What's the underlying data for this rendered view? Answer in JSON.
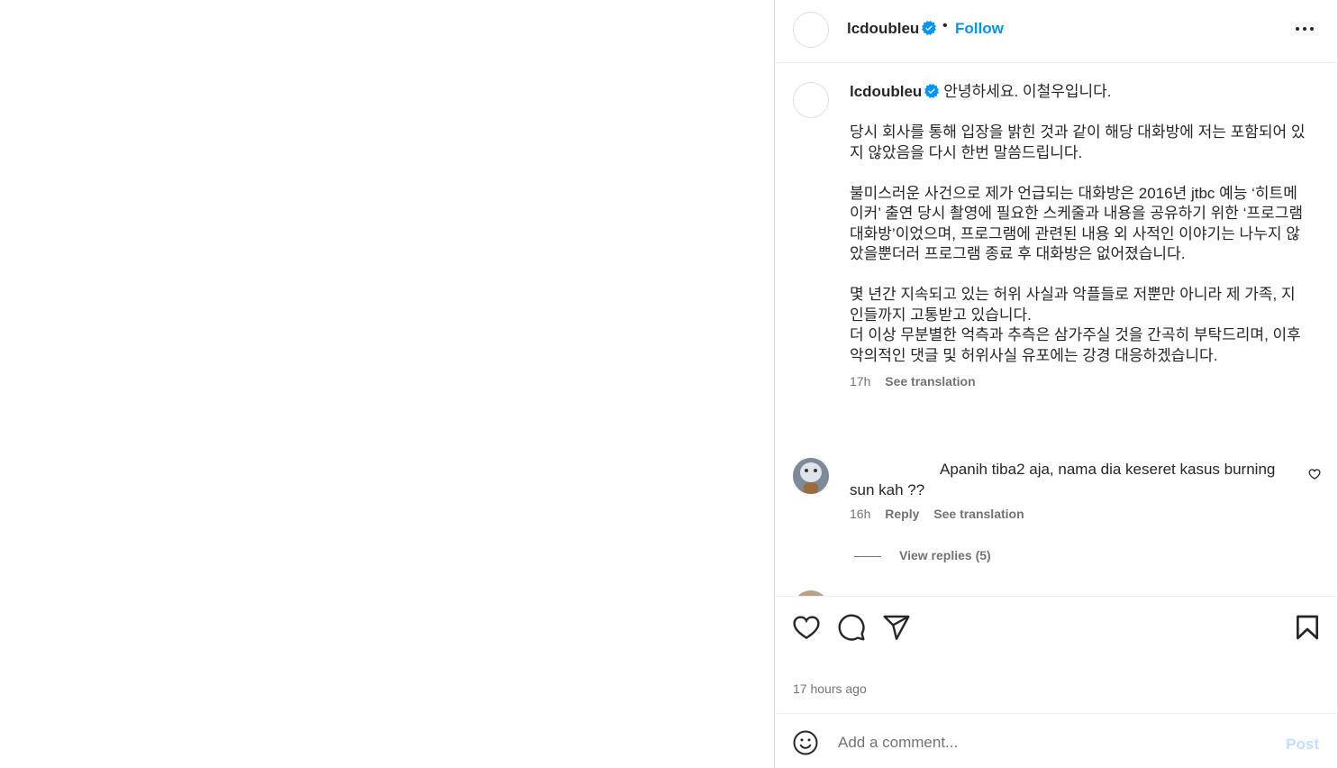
{
  "colors": {
    "accent": "#0095f6",
    "verified": "#0095f6",
    "text": "#262626",
    "muted": "#737373",
    "post_disabled": "#c0dffd"
  },
  "header": {
    "username": "lcdoubleu",
    "separator": "•",
    "follow_label": "Follow"
  },
  "caption": {
    "username": "lcdoubleu",
    "paragraphs": [
      "안녕하세요. 이철우입니다.",
      "당시 회사를 통해 입장을 밝힌 것과 같이 해당 대화방에 저는 포함되어 있지 않았음을 다시 한번 말씀드립니다.",
      "불미스러운 사건으로 제가 언급되는 대화방은 2016년 jtbc 예능 ‘히트메이커’ 출연 당시 촬영에 필요한 스케줄과 내용을 공유하기 위한 ‘프로그램 대화방’이었으며, 프로그램에 관련된 내용 외 사적인 이야기는 나누지 않았을뿐더러 프로그램 종료 후 대화방은 없어졌습니다.",
      "몇 년간 지속되고 있는 허위 사실과 악플들로 저뿐만 아니라 제 가족, 지인들까지 고통받고 있습니다.\n더 이상 무분별한 억측과 추측은 삼가주실 것을 간곡히 부탁드리며, 이후 악의적인 댓글 및 허위사실 유포에는 강경 대응하겠습니다."
    ],
    "time": "17h",
    "see_translation": "See translation"
  },
  "comment": {
    "text": "Apanih tiba2 aja, nama dia keseret kasus burning sun kah ??",
    "time": "16h",
    "reply": "Reply",
    "see_translation": "See translation",
    "view_replies": "View replies (5)",
    "icons": {
      "like": "heart-outline-icon"
    }
  },
  "actions": {
    "icons": [
      "heart-icon",
      "comment-icon",
      "share-icon",
      "bookmark-icon"
    ]
  },
  "timestamp": "17 hours ago",
  "composer": {
    "placeholder": "Add a comment...",
    "post_label": "Post"
  }
}
